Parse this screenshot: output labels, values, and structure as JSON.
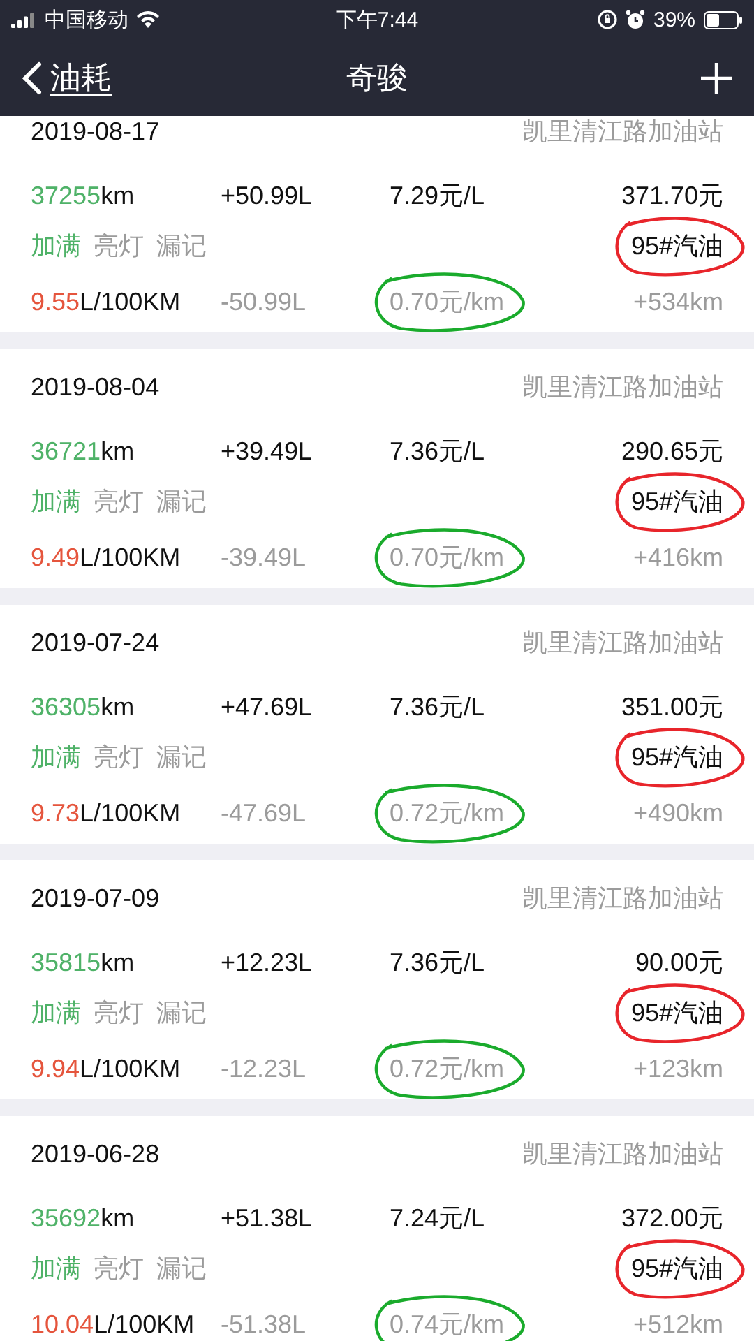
{
  "status_bar": {
    "carrier": "中国移动",
    "time": "下午7:44",
    "battery": "39%"
  },
  "nav": {
    "back": "油耗",
    "title": "奇骏"
  },
  "records": [
    {
      "date": "2019-08-17",
      "station": "凯里清江路加油站",
      "odometer": "37255",
      "odometer_unit": "km",
      "volume": "+50.99L",
      "unit_price": "7.29元/L",
      "cost": "371.70元",
      "tags": [
        {
          "label": "加满",
          "on": true
        },
        {
          "label": "亮灯",
          "on": false
        },
        {
          "label": "漏记",
          "on": false
        }
      ],
      "fuel": "95#汽油",
      "fuel_circled": true,
      "consumption": "9.55",
      "consumption_unit": "L/100KM",
      "volume_delta": "-50.99L",
      "cost_per_km": "0.70元/km",
      "cost_per_km_circled": true,
      "distance": "+534km"
    },
    {
      "date": "2019-08-04",
      "station": "凯里清江路加油站",
      "odometer": "36721",
      "odometer_unit": "km",
      "volume": "+39.49L",
      "unit_price": "7.36元/L",
      "cost": "290.65元",
      "tags": [
        {
          "label": "加满",
          "on": true
        },
        {
          "label": "亮灯",
          "on": false
        },
        {
          "label": "漏记",
          "on": false
        }
      ],
      "fuel": "95#汽油",
      "fuel_circled": true,
      "consumption": "9.49",
      "consumption_unit": "L/100KM",
      "volume_delta": "-39.49L",
      "cost_per_km": "0.70元/km",
      "cost_per_km_circled": true,
      "distance": "+416km"
    },
    {
      "date": "2019-07-24",
      "station": "凯里清江路加油站",
      "odometer": "36305",
      "odometer_unit": "km",
      "volume": "+47.69L",
      "unit_price": "7.36元/L",
      "cost": "351.00元",
      "tags": [
        {
          "label": "加满",
          "on": true
        },
        {
          "label": "亮灯",
          "on": false
        },
        {
          "label": "漏记",
          "on": false
        }
      ],
      "fuel": "95#汽油",
      "fuel_circled": true,
      "consumption": "9.73",
      "consumption_unit": "L/100KM",
      "volume_delta": "-47.69L",
      "cost_per_km": "0.72元/km",
      "cost_per_km_circled": true,
      "distance": "+490km"
    },
    {
      "date": "2019-07-09",
      "station": "凯里清江路加油站",
      "odometer": "35815",
      "odometer_unit": "km",
      "volume": "+12.23L",
      "unit_price": "7.36元/L",
      "cost": "90.00元",
      "tags": [
        {
          "label": "加满",
          "on": true
        },
        {
          "label": "亮灯",
          "on": false
        },
        {
          "label": "漏记",
          "on": false
        }
      ],
      "fuel": "95#汽油",
      "fuel_circled": true,
      "consumption": "9.94",
      "consumption_unit": "L/100KM",
      "volume_delta": "-12.23L",
      "cost_per_km": "0.72元/km",
      "cost_per_km_circled": true,
      "distance": "+123km"
    },
    {
      "date": "2019-06-28",
      "station": "凯里清江路加油站",
      "odometer": "35692",
      "odometer_unit": "km",
      "volume": "+51.38L",
      "unit_price": "7.24元/L",
      "cost": "372.00元",
      "tags": [
        {
          "label": "加满",
          "on": true
        },
        {
          "label": "亮灯",
          "on": false
        },
        {
          "label": "漏记",
          "on": false
        }
      ],
      "fuel": "95#汽油",
      "fuel_circled": true,
      "consumption": "10.04",
      "consumption_unit": "L/100KM",
      "volume_delta": "-51.38L",
      "cost_per_km": "0.74元/km",
      "cost_per_km_circled": true,
      "distance": "+512km"
    }
  ]
}
